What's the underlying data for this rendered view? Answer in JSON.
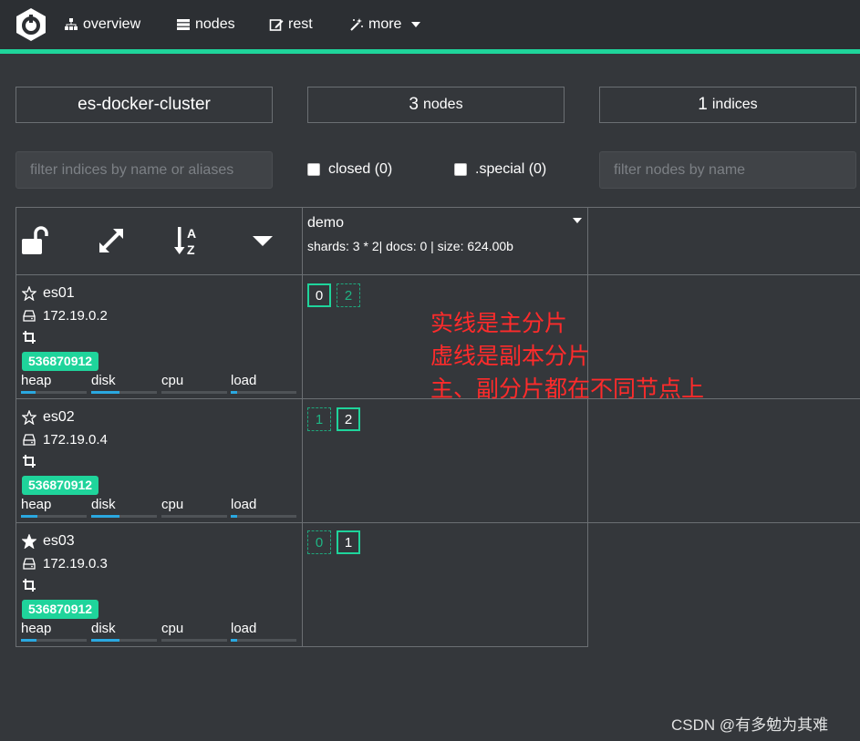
{
  "nav": {
    "items": [
      {
        "label": "overview",
        "icon": "sitemap-icon"
      },
      {
        "label": "nodes",
        "icon": "server-icon"
      },
      {
        "label": "rest",
        "icon": "edit-icon"
      },
      {
        "label": "more",
        "icon": "magic-wand-icon"
      }
    ]
  },
  "colors": {
    "accent": "#1fd49b",
    "background": "#34373b",
    "annotation": "#ff2b2b"
  },
  "stats": {
    "cluster_name": "es-docker-cluster",
    "nodes_count": "3",
    "nodes_label": "nodes",
    "indices_count": "1",
    "indices_label": "indices"
  },
  "filters": {
    "indices_placeholder": "filter indices by name or aliases",
    "closed_label": "closed (0)",
    "special_label": ".special (0)",
    "nodes_placeholder": "filter nodes by name"
  },
  "index": {
    "name": "demo",
    "meta": "shards: 3 * 2| docs: 0 | size: 624.00b"
  },
  "nodes": [
    {
      "name": "es01",
      "ip": "172.19.0.2",
      "badge": "536870912",
      "master": false,
      "shards": [
        {
          "n": "0",
          "type": "primary"
        },
        {
          "n": "2",
          "type": "replica"
        }
      ],
      "metrics": {
        "heap": 0.22,
        "disk": 0.43,
        "cpu": 0.0,
        "load": 0.1
      }
    },
    {
      "name": "es02",
      "ip": "172.19.0.4",
      "badge": "536870912",
      "master": false,
      "shards": [
        {
          "n": "1",
          "type": "replica"
        },
        {
          "n": "2",
          "type": "primary"
        }
      ],
      "metrics": {
        "heap": 0.25,
        "disk": 0.43,
        "cpu": 0.0,
        "load": 0.1
      }
    },
    {
      "name": "es03",
      "ip": "172.19.0.3",
      "badge": "536870912",
      "master": true,
      "shards": [
        {
          "n": "0",
          "type": "replica"
        },
        {
          "n": "1",
          "type": "primary"
        }
      ],
      "metrics": {
        "heap": 0.24,
        "disk": 0.43,
        "cpu": 0.0,
        "load": 0.1
      }
    }
  ],
  "metric_labels": {
    "heap": "heap",
    "disk": "disk",
    "cpu": "cpu",
    "load": "load"
  },
  "annotation": {
    "line1": "实线是主分片",
    "line2": "虚线是副本分片",
    "line3": "主、副分片都在不同节点上"
  },
  "watermark": "CSDN @有多勉为其难"
}
